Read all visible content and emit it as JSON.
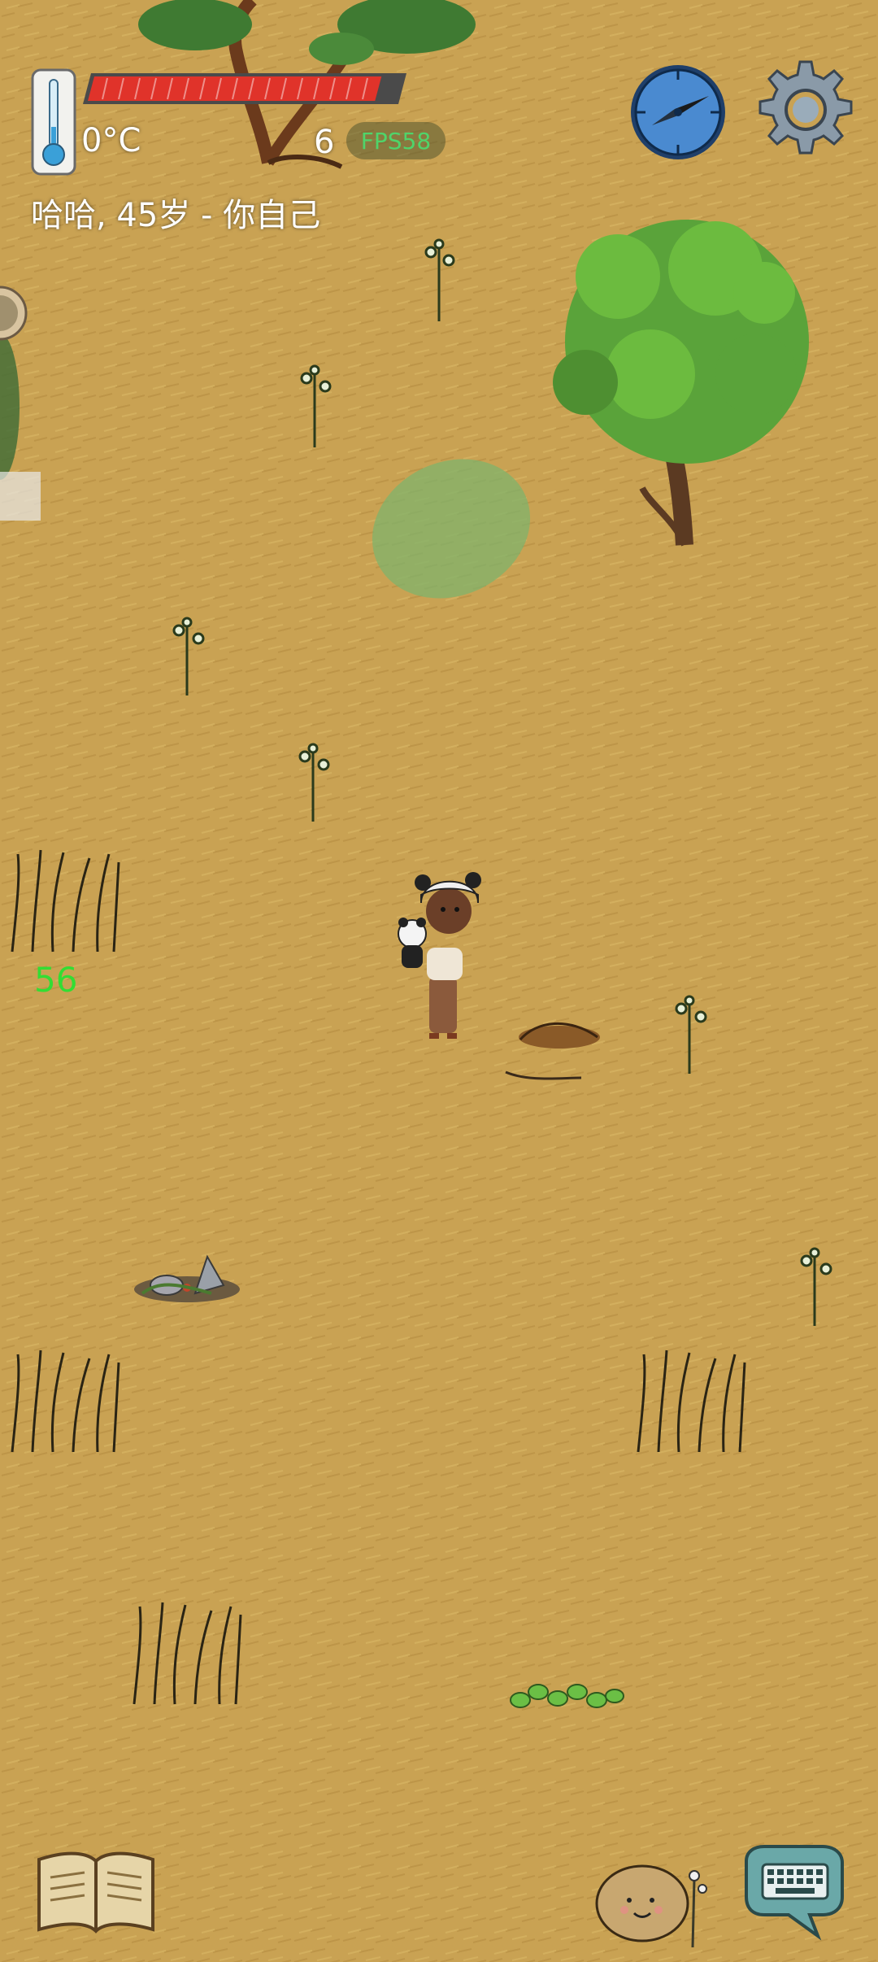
{
  "hud": {
    "temperature": "0°C",
    "player_info": "哈哈, 45岁 - 你自己",
    "food_count": "6",
    "fps": "FPS58",
    "food_meter_fraction": 0.92,
    "floating_number": "56"
  },
  "icons": {
    "thermometer": "thermometer-icon",
    "compass": "compass-icon",
    "settings": "gear-icon",
    "book": "open-book-icon",
    "emote": "emote-potato-icon",
    "keyboard": "keyboard-chat-icon"
  },
  "colors": {
    "ground": "#c9a253",
    "food_bar": "#e0332a",
    "fps_text": "#4fd46a",
    "floating_number": "#33dd33"
  }
}
